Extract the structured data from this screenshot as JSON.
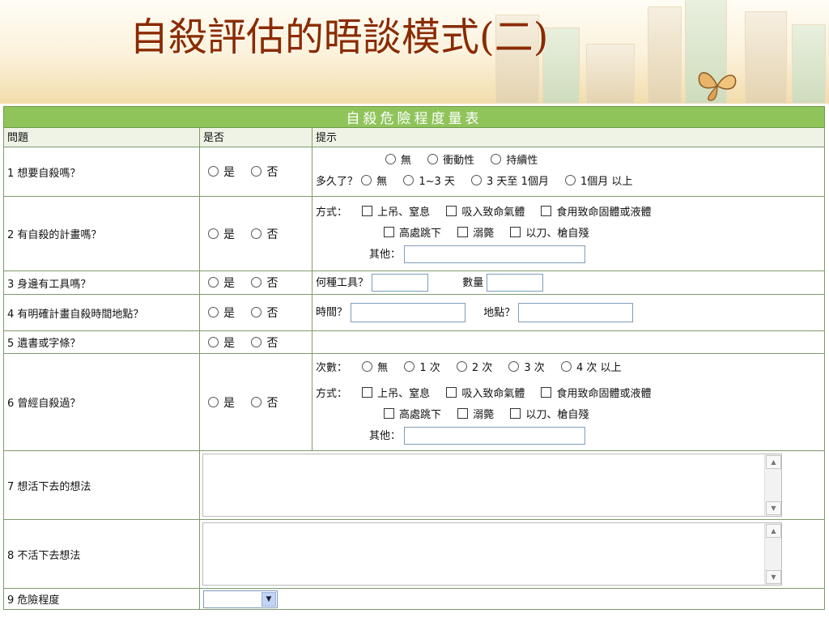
{
  "slide_title": "自殺評估的晤談模式(二)",
  "form_title": "自殺危險程度量表",
  "columns": [
    "問題",
    "是否",
    "提示"
  ],
  "yes": "是",
  "no": "否",
  "other_label": "其他：",
  "rows": {
    "q1": {
      "label": "1 想要自殺嗎？",
      "opts": [
        "無",
        "衝動性",
        "持續性"
      ],
      "duration_label": "多久了？",
      "duration_opts": [
        "無",
        "1~3 天",
        "3 天至 1個月",
        "1個月 以上"
      ]
    },
    "q2": {
      "label": "2 有自殺的計畫嗎？",
      "method_label": "方式：",
      "methods": [
        "上吊、窒息",
        "吸入致命氣體",
        "食用致命固體或液體",
        "高處跳下",
        "溺斃",
        "以刀、槍自殘"
      ]
    },
    "q3": {
      "label": "3 身邊有工具嗎？",
      "tool_label": "何種工具？",
      "qty_label": "數量"
    },
    "q4": {
      "label": "4 有明確計畫自殺時間地點？",
      "time_label": "時間？",
      "place_label": "地點？"
    },
    "q5": {
      "label": "5 遺書或字條？"
    },
    "q6": {
      "label": "6 曾經自殺過？",
      "count_label": "次數：",
      "counts": [
        "無",
        "1 次",
        "2 次",
        "3 次",
        "4 次 以上"
      ],
      "method_label": "方式：",
      "methods": [
        "上吊、窒息",
        "吸入致命氣體",
        "食用致命固體或液體",
        "高處跳下",
        "溺斃",
        "以刀、槍自殘"
      ]
    },
    "q7": {
      "label": "7 想活下去的想法"
    },
    "q8": {
      "label": "8 不活下去想法"
    },
    "q9": {
      "label": "9 危險程度"
    }
  }
}
